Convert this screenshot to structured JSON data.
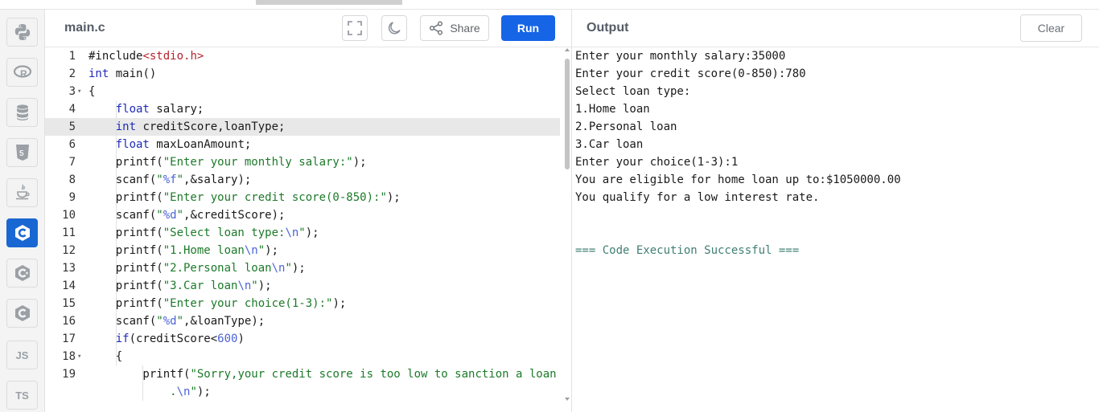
{
  "editor": {
    "filename": "main.c",
    "share_label": "Share",
    "run_label": "Run",
    "lines": [
      {
        "n": "1",
        "fold": "",
        "html": "#include<span class='p'>&lt;stdio.h&gt;</span>"
      },
      {
        "n": "2",
        "fold": "",
        "html": "<span class='k'>int</span> main()"
      },
      {
        "n": "3",
        "fold": "▾",
        "html": "{"
      },
      {
        "n": "4",
        "fold": "",
        "html": "    <span class='k'>float</span> salary;"
      },
      {
        "n": "5",
        "fold": "",
        "html": "    <span class='k'>int</span> creditScore,loanType;"
      },
      {
        "n": "6",
        "fold": "",
        "html": "    <span class='k'>float</span> maxLoanAmount;"
      },
      {
        "n": "7",
        "fold": "",
        "html": "    printf(<span class='s'>\"Enter your monthly salary:\"</span>);"
      },
      {
        "n": "8",
        "fold": "",
        "html": "    scanf(<span class='s'>\"<span class='esc'>%f</span>\"</span>,&amp;salary);"
      },
      {
        "n": "9",
        "fold": "",
        "html": "    printf(<span class='s'>\"Enter your credit score(0-850):\"</span>);"
      },
      {
        "n": "10",
        "fold": "",
        "html": "    scanf(<span class='s'>\"<span class='esc'>%d</span>\"</span>,&amp;creditScore);"
      },
      {
        "n": "11",
        "fold": "",
        "html": "    printf(<span class='s'>\"Select loan type:<span class='esc'>\\n</span>\"</span>);"
      },
      {
        "n": "12",
        "fold": "",
        "html": "    printf(<span class='s'>\"1.Home loan<span class='esc'>\\n</span>\"</span>);"
      },
      {
        "n": "13",
        "fold": "",
        "html": "    printf(<span class='s'>\"2.Personal loan<span class='esc'>\\n</span>\"</span>);"
      },
      {
        "n": "14",
        "fold": "",
        "html": "    printf(<span class='s'>\"3.Car loan<span class='esc'>\\n</span>\"</span>);"
      },
      {
        "n": "15",
        "fold": "",
        "html": "    printf(<span class='s'>\"Enter your choice(1-3):\"</span>);"
      },
      {
        "n": "16",
        "fold": "",
        "html": "    scanf(<span class='s'>\"<span class='esc'>%d</span>\"</span>,&amp;loanType);"
      },
      {
        "n": "17",
        "fold": "",
        "html": "    <span class='k'>if</span>(creditScore&lt;<span class='n'>600</span>)"
      },
      {
        "n": "18",
        "fold": "▾",
        "html": "    {"
      },
      {
        "n": "19",
        "fold": "",
        "html": "        printf(<span class='s'>\"Sorry,your credit score is too low to sanction a loan</span>"
      },
      {
        "n": "",
        "fold": "",
        "html": "            <span class='s'>.<span class='esc'>\\n</span>\"</span>);"
      }
    ]
  },
  "output": {
    "title": "Output",
    "clear_label": "Clear",
    "lines": [
      "Enter your monthly salary:35000",
      "Enter your credit score(0-850):780",
      "Select loan type:",
      "1.Home loan",
      "2.Personal loan",
      "3.Car loan",
      "Enter your choice(1-3):1",
      "You are eligible for home loan up to:$1050000.00",
      "You qualify for a low interest rate.",
      "",
      "",
      "=== Code Execution Successful ==="
    ]
  },
  "sidebar": {
    "languages": [
      {
        "name": "python-icon",
        "label": ""
      },
      {
        "name": "r-icon",
        "label": ""
      },
      {
        "name": "database-icon",
        "label": ""
      },
      {
        "name": "html5-icon",
        "label": ""
      },
      {
        "name": "java-icon",
        "label": ""
      },
      {
        "name": "c-icon",
        "label": ""
      },
      {
        "name": "cpp-icon",
        "label": ""
      },
      {
        "name": "csharp-icon",
        "label": ""
      },
      {
        "name": "javascript-icon",
        "label": "JS"
      },
      {
        "name": "typescript-icon",
        "label": "TS"
      }
    ],
    "active_language": "c-icon",
    "active_color": "#1967d2"
  }
}
